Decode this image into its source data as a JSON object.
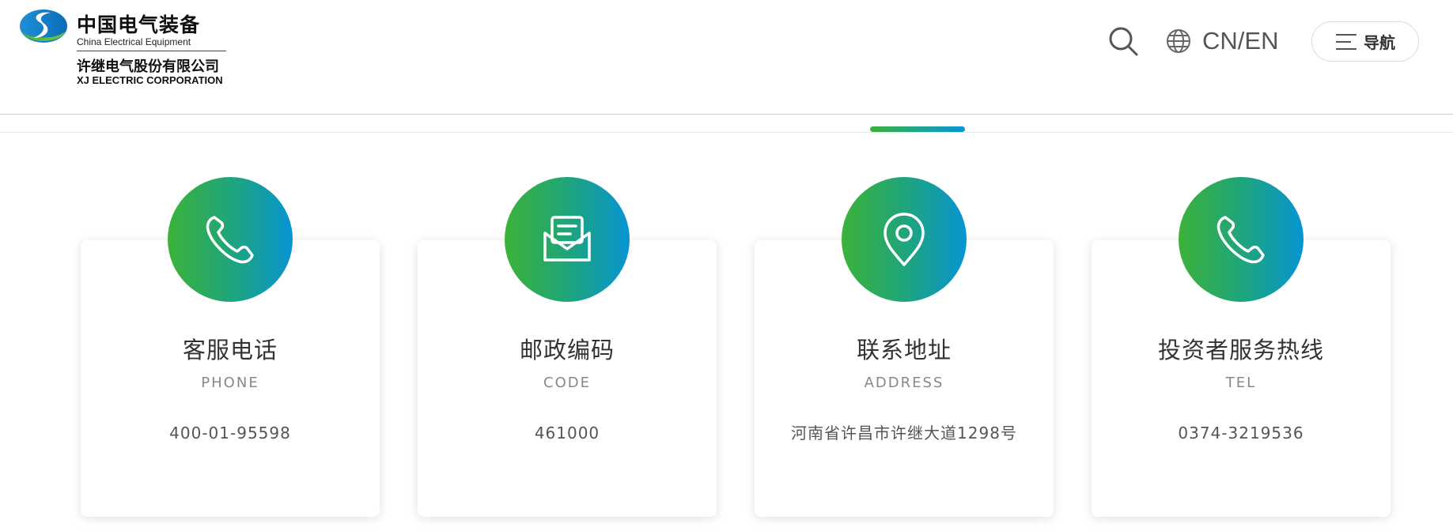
{
  "brand": {
    "name_cn": "中国电气装备",
    "name_en": "China Electrical Equipment",
    "company_cn": "许继电气股份有限公司",
    "company_en": "XJ ELECTRIC CORPORATION"
  },
  "header": {
    "language_label": "CN/EN",
    "nav_label": "导航",
    "icons": {
      "search": "search-icon",
      "language": "globe-icon",
      "menu": "menu-icon"
    }
  },
  "colors": {
    "gradient_start": "#3db13d",
    "gradient_end": "#0896d4"
  },
  "contacts": [
    {
      "title": "客服电话",
      "subtitle": "PHONE",
      "value": "400-01-95598",
      "icon": "phone-icon"
    },
    {
      "title": "邮政编码",
      "subtitle": "CODE",
      "value": "461000",
      "icon": "mail-icon"
    },
    {
      "title": "联系地址",
      "subtitle": "ADDRESS",
      "value": "河南省许昌市许继大道1298号",
      "icon": "location-pin-icon"
    },
    {
      "title": "投资者服务热线",
      "subtitle": "TEL",
      "value": "0374-3219536",
      "icon": "phone-icon"
    }
  ]
}
